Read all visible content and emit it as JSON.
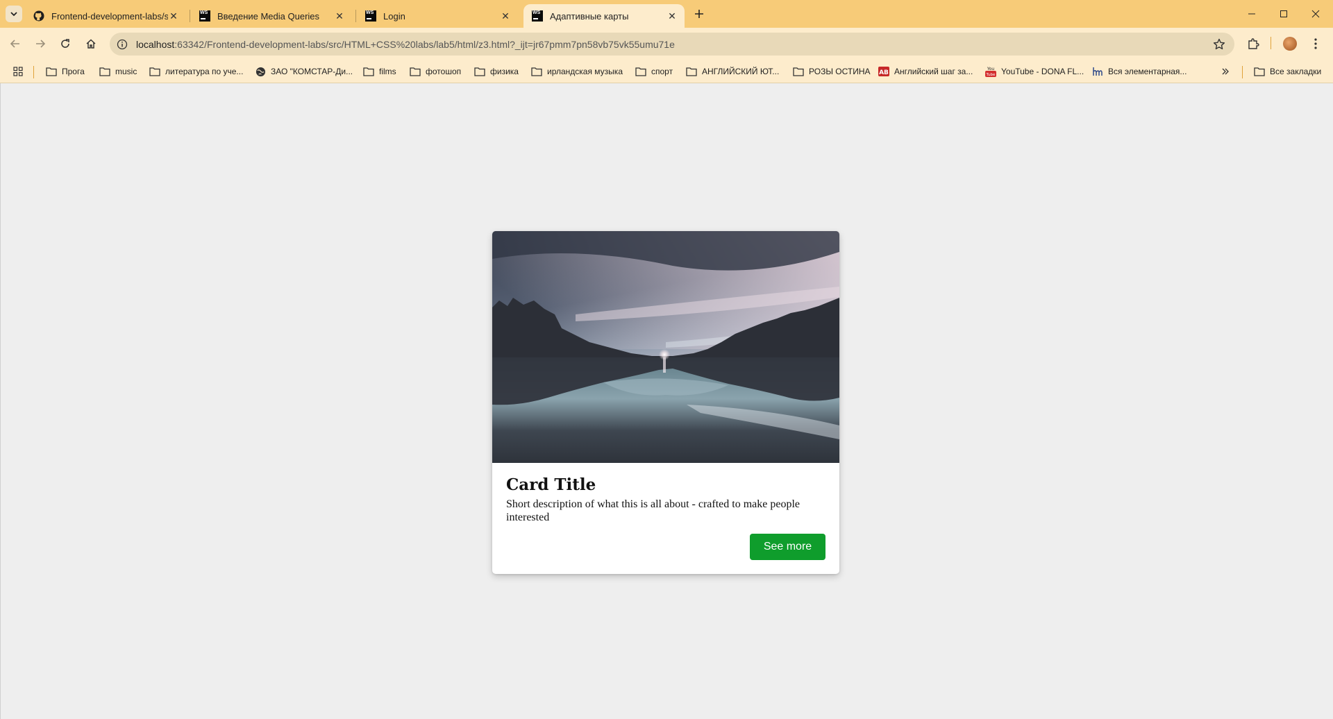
{
  "browser": {
    "tabs": [
      {
        "title": "Frontend-development-labs/src",
        "favicon": "github-icon",
        "active": false
      },
      {
        "title": "Введение Media Queries",
        "favicon": "webstorm-icon",
        "active": false
      },
      {
        "title": "Login",
        "favicon": "webstorm-icon",
        "active": false
      },
      {
        "title": "Адаптивные карты",
        "favicon": "webstorm-icon",
        "active": true
      }
    ],
    "url_host": "localhost",
    "url_rest": ":63342/Frontend-development-labs/src/HTML+CSS%20labs/lab5/html/z3.html?_ijt=jr67pmm7pn58vb75vk55umu71e",
    "accent_color": "#f7cb78"
  },
  "bookmarks": {
    "items": [
      {
        "label": "Прога",
        "icon": "folder-icon"
      },
      {
        "label": "music",
        "icon": "folder-icon"
      },
      {
        "label": "литература по уче...",
        "icon": "folder-icon"
      },
      {
        "label": "ЗАО \"КОМСТАР-Ди...",
        "icon": "globe-icon"
      },
      {
        "label": "films",
        "icon": "folder-icon"
      },
      {
        "label": "фотошоп",
        "icon": "folder-icon"
      },
      {
        "label": "физика",
        "icon": "folder-icon"
      },
      {
        "label": "ирландская музыка",
        "icon": "folder-icon"
      },
      {
        "label": "спорт",
        "icon": "folder-icon"
      },
      {
        "label": "АНГЛИЙСКИЙ ЮТ...",
        "icon": "folder-icon"
      },
      {
        "label": "РОЗЫ ОСТИНА",
        "icon": "folder-icon"
      },
      {
        "label": "Английский шаг за...",
        "icon": "ab-icon"
      },
      {
        "label": "YouTube - DONA FL...",
        "icon": "youtube-icon"
      },
      {
        "label": "Вся элементарная...",
        "icon": "hm-icon"
      }
    ],
    "all_bookmarks": "Все закладки"
  },
  "card": {
    "title": "Card Title",
    "description": "Short description of what this is all about - crafted to make people interested",
    "button_label": "See more",
    "button_color": "#0f9d2c"
  }
}
